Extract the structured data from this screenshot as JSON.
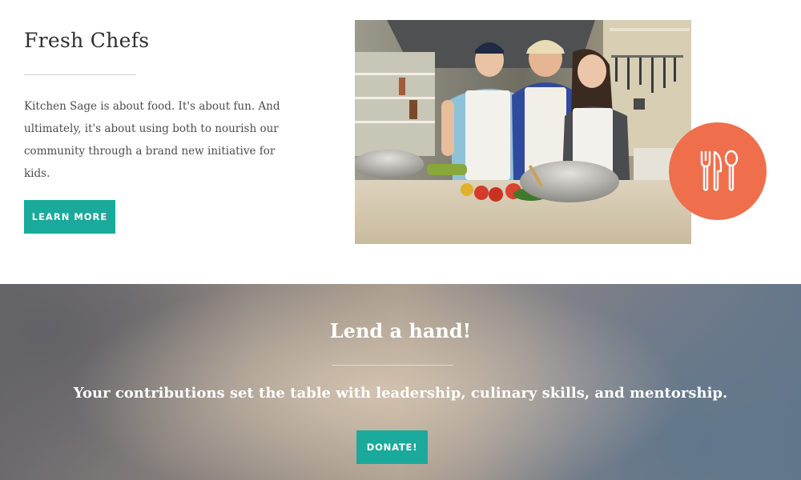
{
  "feature": {
    "title": "Fresh Chefs",
    "description": "Kitchen Sage is about food. It's about fun. And ultimately, it's about using both to nourish our community through a brand new initiative for kids.",
    "button_label": "LEARN MORE",
    "badge_icon": "utensils-icon"
  },
  "banner": {
    "title": "Lend a hand!",
    "subtitle": "Your contributions set the table with leadership, culinary skills, and mentorship.",
    "button_label": "DONATE!"
  },
  "colors": {
    "accent": "#1aaa9b",
    "badge": "#ef6f4d",
    "heading": "#2f2f2f",
    "body": "#4d4d4d"
  }
}
